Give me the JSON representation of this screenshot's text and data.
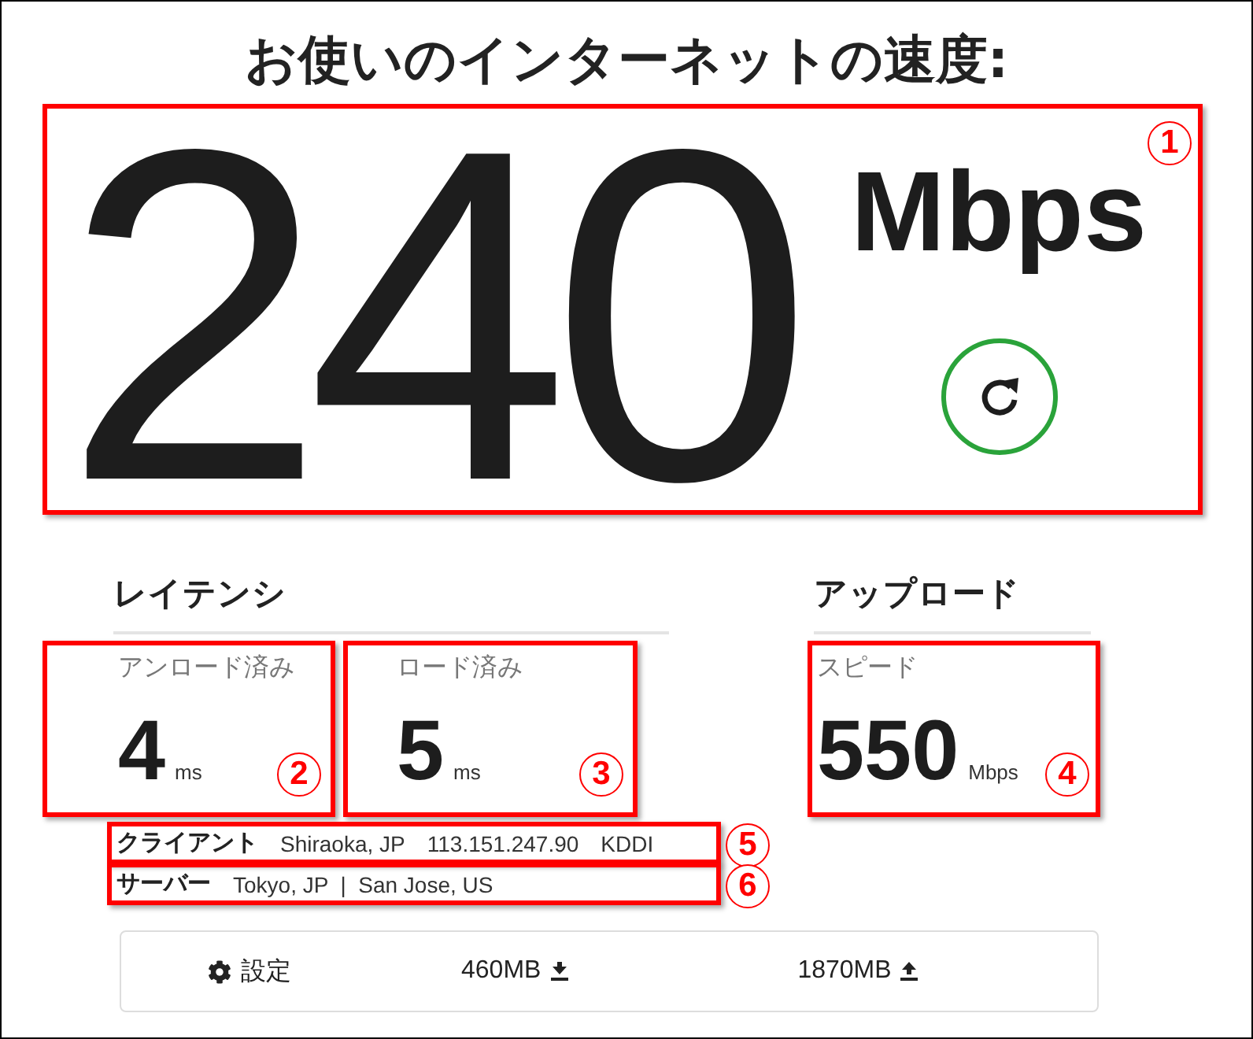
{
  "title": "お使いのインターネットの速度:",
  "download": {
    "value": "240",
    "unit": "Mbps",
    "annotation": "1"
  },
  "latency": {
    "heading": "レイテンシ",
    "items": [
      {
        "label": "アンロード済み",
        "value": "4",
        "unit": "ms",
        "annotation": "2"
      },
      {
        "label": "ロード済み",
        "value": "5",
        "unit": "ms",
        "annotation": "3"
      }
    ]
  },
  "upload": {
    "heading": "アップロード",
    "label": "スピード",
    "value": "550",
    "unit": "Mbps",
    "annotation": "4"
  },
  "info": [
    {
      "label": "クライアント",
      "parts": [
        "Shiraoka, JP",
        "113.151.247.90",
        "KDDI"
      ],
      "annotation": "5"
    },
    {
      "label": "サーバー",
      "parts": [
        "Tokyo, JP  |  San Jose, US"
      ],
      "annotation": "6"
    }
  ],
  "footer": {
    "settings": "設定",
    "download": "460MB",
    "upload": "1870MB"
  }
}
